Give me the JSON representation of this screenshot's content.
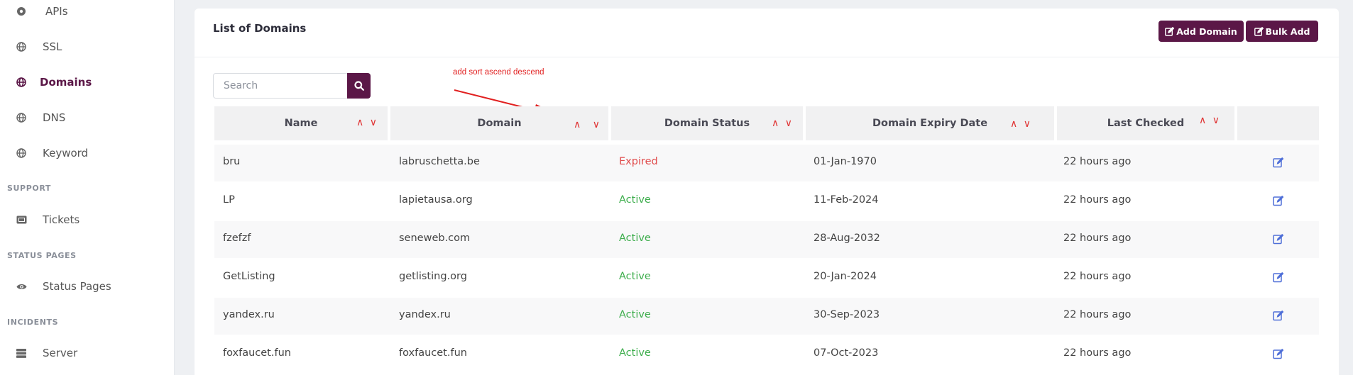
{
  "sidebar": {
    "items": [
      {
        "label": "APIs",
        "icon": "circle-dot-icon"
      },
      {
        "label": "SSL",
        "icon": "globe-icon"
      },
      {
        "label": "Domains",
        "icon": "globe-icon",
        "active": true
      },
      {
        "label": "DNS",
        "icon": "globe-icon"
      },
      {
        "label": "Keyword",
        "icon": "globe-icon"
      }
    ],
    "support_heading": "SUPPORT",
    "tickets": {
      "label": "Tickets",
      "icon": "ticket-icon"
    },
    "status_heading": "STATUS PAGES",
    "status_pages": {
      "label": "Status Pages",
      "icon": "eye-icon"
    },
    "incidents_heading": "INCIDENTS",
    "server": {
      "label": "Server",
      "icon": "server-icon"
    }
  },
  "card": {
    "title": "List of Domains",
    "add_domain_label": "Add Domain",
    "bulk_add_label": "Bulk Add"
  },
  "search": {
    "placeholder": "Search",
    "value": ""
  },
  "annotation": {
    "text": "add sort ascend descend"
  },
  "table": {
    "headers": [
      "Name",
      "Domain",
      "Domain Status",
      "Domain Expiry Date",
      "Last Checked"
    ],
    "sort_glyph": "∧ ∨",
    "rows": [
      {
        "name": "bru",
        "domain": "labruschetta.be",
        "status": "Expired",
        "expiry": "01-Jan-1970",
        "checked": "22 hours ago"
      },
      {
        "name": "LP",
        "domain": "lapietausa.org",
        "status": "Active",
        "expiry": "11-Feb-2024",
        "checked": "22 hours ago"
      },
      {
        "name": "fzefzf",
        "domain": "seneweb.com",
        "status": "Active",
        "expiry": "28-Aug-2032",
        "checked": "22 hours ago"
      },
      {
        "name": "GetListing",
        "domain": "getlisting.org",
        "status": "Active",
        "expiry": "20-Jan-2024",
        "checked": "22 hours ago"
      },
      {
        "name": "yandex.ru",
        "domain": "yandex.ru",
        "status": "Active",
        "expiry": "30-Sep-2023",
        "checked": "22 hours ago"
      },
      {
        "name": "foxfaucet.fun",
        "domain": "foxfaucet.fun",
        "status": "Active",
        "expiry": "07-Oct-2023",
        "checked": "22 hours ago"
      }
    ]
  },
  "colors": {
    "brand": "#5b1747",
    "active_status": "#3fae4e",
    "expired_status": "#e04b4b",
    "annotation": "#e12020",
    "edit_icon": "#4f6fd8"
  }
}
